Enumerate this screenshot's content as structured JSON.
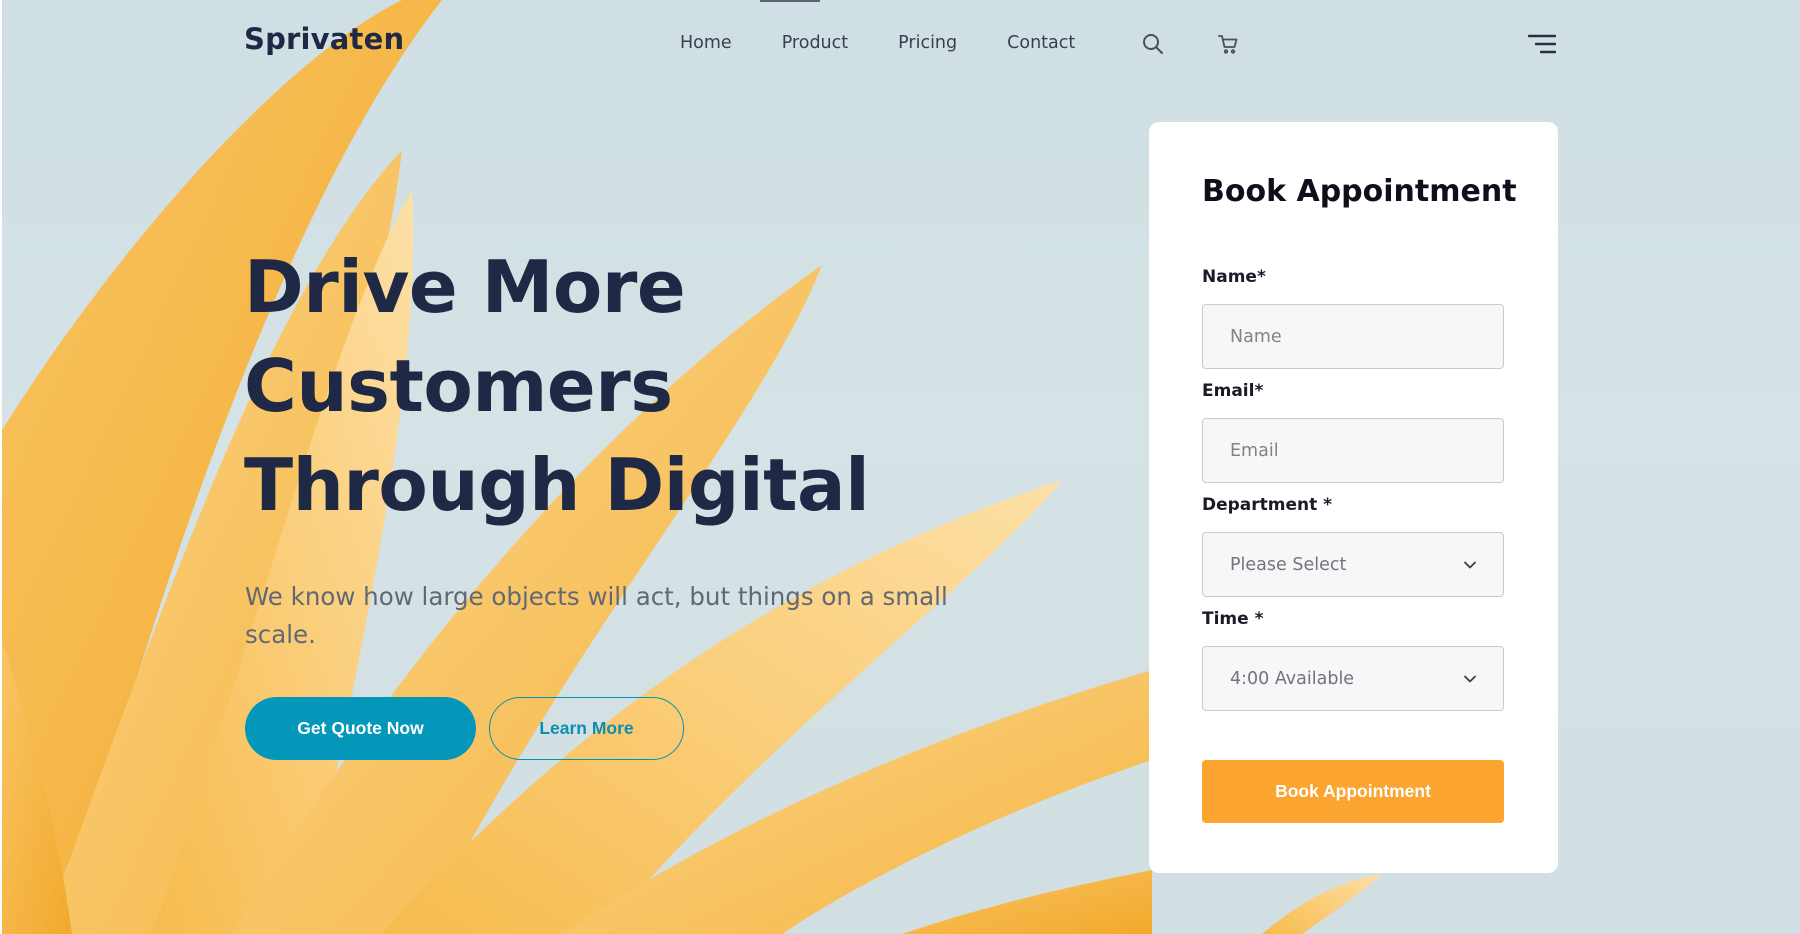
{
  "brand": {
    "name": "Sprivaten"
  },
  "nav": {
    "items": [
      {
        "label": "Home"
      },
      {
        "label": "Product"
      },
      {
        "label": "Pricing"
      },
      {
        "label": "Contact"
      }
    ],
    "icons": {
      "search": "search-icon",
      "cart": "cart-icon",
      "menu": "hamburger-menu-icon"
    }
  },
  "hero": {
    "headline": [
      "Drive More",
      "Customers",
      "Through Digital"
    ],
    "subtext": "We know how large objects will act, but things on a small scale.",
    "primary_cta": "Get Quote Now",
    "secondary_cta": "Learn More"
  },
  "form": {
    "title": "Book Appointment",
    "name_label": "Name*",
    "name_placeholder": "Name",
    "email_label": "Email*",
    "email_placeholder": "Email",
    "department_label": "Department *",
    "department_value": "Please Select",
    "time_label": "Time *",
    "time_value": "4:00 Available",
    "submit_label": "Book Appointment"
  },
  "colors": {
    "primary": "#0597ba",
    "accent": "#fba430",
    "heading": "#1f2844",
    "background": "#d3e1e5"
  }
}
